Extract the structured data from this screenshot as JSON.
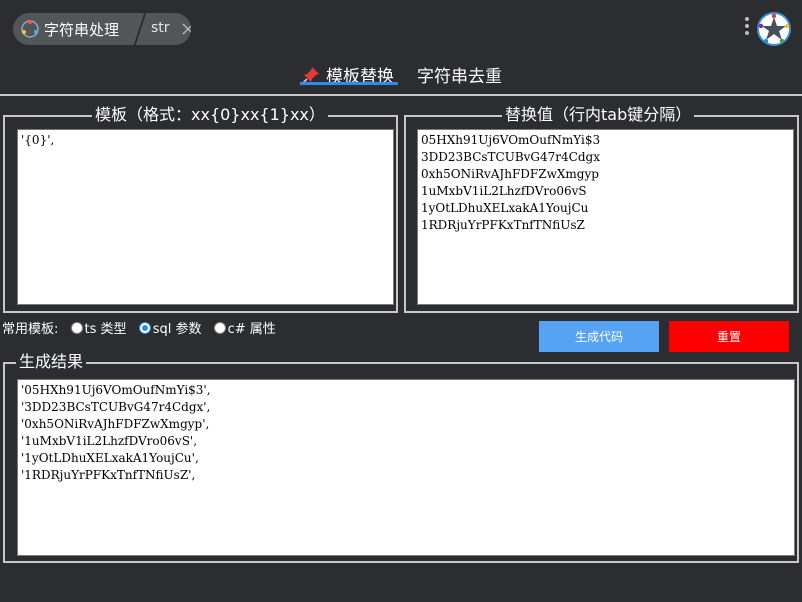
{
  "titlebar": {
    "app_title": "字符串处理",
    "tab_label": "str"
  },
  "mode_tabs": [
    {
      "label": "模板替换",
      "active": true
    },
    {
      "label": "字符串去重",
      "active": false
    }
  ],
  "template_box": {
    "legend": "模板（格式：xx{0}xx{1}xx）",
    "value": "'{0}',"
  },
  "replace_box": {
    "legend": "替换值（行内tab键分隔）",
    "value": "05HXh91Uj6VOmOufNmYi$3\n3DD23BCsTCUBvG47r4Cdgx\n0xh5ONiRvAJhFDFZwXmgyp\n1uMxbV1iL2LhzfDVro06vS\n1yOtLDhuXELxakA1YoujCu\n1RDRjuYrPFKxTnfTNfiUsZ"
  },
  "options": {
    "label": "常用模板:",
    "items": [
      {
        "label": "ts 类型",
        "checked": false
      },
      {
        "label": "sql 参数",
        "checked": true
      },
      {
        "label": "c# 属性",
        "checked": false
      }
    ]
  },
  "buttons": {
    "generate": "生成代码",
    "reset": "重置"
  },
  "result_box": {
    "legend": "生成结果",
    "value": "'05HXh91Uj6VOmOufNmYi$3',\n'3DD23BCsTCUBvG47r4Cdgx',\n'0xh5ONiRvAJhFDFZwXmgyp',\n'1uMxbV1iL2LhzfDVro06vS',\n'1yOtLDhuXELxakA1YoujCu',\n'1RDRjuYrPFKxTnfTNfiUsZ',"
  },
  "colors": {
    "background": "#2b2d30",
    "accent": "#2d8cf0",
    "generate_button": "#57a3f3",
    "reset_button": "#ff0000"
  },
  "icons": [
    "app-icon",
    "close-icon",
    "more-vertical-icon",
    "logo-icon",
    "pin-icon"
  ]
}
